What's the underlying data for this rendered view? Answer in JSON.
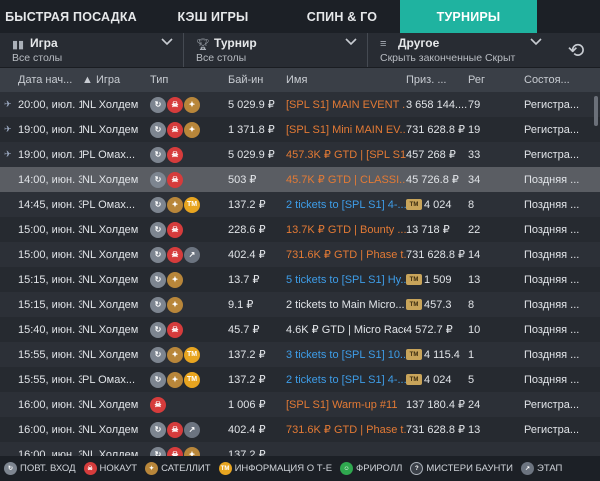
{
  "tabs": [
    "БЫСТРАЯ ПОСАДКА",
    "КЭШ ИГРЫ",
    "СПИН & ГО",
    "ТУРНИРЫ"
  ],
  "filters": [
    {
      "title": "Игра",
      "sub": "Все столы"
    },
    {
      "title": "Турнир",
      "sub": "Все столы"
    },
    {
      "title": "Другое",
      "sub": "Скрыть законченные Скрыт"
    }
  ],
  "headers": [
    "Дата нач...",
    "Игра",
    "Тип",
    "Бай-ин",
    "Имя",
    "Приз. ...",
    "Рег",
    "Состоя..."
  ],
  "rows": [
    {
      "pin": true,
      "date": "20:00, июл. 12",
      "game": "NL Холдем",
      "types": [
        "rebuy",
        "ko",
        "sat"
      ],
      "buyin": "5 029.9 ₽",
      "name": "[SPL S1] MAIN EVENT ...",
      "nameColor": "orange",
      "prize": "3 658 144....",
      "ticket": false,
      "reg": "79",
      "status": "Регистра...",
      "sel": false
    },
    {
      "pin": true,
      "date": "19:00, июл. 12",
      "game": "NL Холдем",
      "types": [
        "rebuy",
        "ko",
        "sat"
      ],
      "buyin": "1 371.8 ₽",
      "name": "[SPL S1] Mini MAIN EV...",
      "nameColor": "orange",
      "prize": "731 628.8 ₽",
      "ticket": false,
      "reg": "19",
      "status": "Регистра...",
      "sel": false
    },
    {
      "pin": true,
      "date": "19:00, июл. 13",
      "game": "PL Омах...",
      "types": [
        "rebuy",
        "ko"
      ],
      "buyin": "5 029.9 ₽",
      "name": "457.3K ₽ GTD | [SPL S1]...",
      "nameColor": "orange",
      "prize": "457 268 ₽",
      "ticket": false,
      "reg": "33",
      "status": "Регистра...",
      "sel": false
    },
    {
      "pin": false,
      "date": "14:00, июн. 30",
      "game": "NL Холдем",
      "types": [
        "rebuy",
        "ko"
      ],
      "buyin": "503 ₽",
      "name": "45.7K ₽ GTD | CLASSI...",
      "nameColor": "orange",
      "prize": "45 726.8 ₽",
      "ticket": false,
      "reg": "34",
      "status": "Поздняя ...",
      "sel": true
    },
    {
      "pin": false,
      "date": "14:45, июн. 30",
      "game": "PL Омах...",
      "types": [
        "rebuy",
        "sat",
        "tm"
      ],
      "buyin": "137.2 ₽",
      "name": "2 tickets to [SPL S1] 4-...",
      "nameColor": "blue",
      "prize": "4 024",
      "ticket": true,
      "reg": "8",
      "status": "Поздняя ...",
      "sel": false
    },
    {
      "pin": false,
      "date": "15:00, июн. 30",
      "game": "NL Холдем",
      "types": [
        "rebuy",
        "ko"
      ],
      "buyin": "228.6 ₽",
      "name": "13.7K ₽ GTD | Bounty ...",
      "nameColor": "orange",
      "prize": "13 718 ₽",
      "ticket": false,
      "reg": "22",
      "status": "Поздняя ...",
      "sel": false
    },
    {
      "pin": false,
      "date": "15:00, июн. 30",
      "game": "NL Холдем",
      "types": [
        "rebuy",
        "ko",
        "stage"
      ],
      "buyin": "402.4 ₽",
      "name": "731.6K ₽ GTD | Phase t...",
      "nameColor": "orange",
      "prize": "731 628.8 ₽",
      "ticket": false,
      "reg": "14",
      "status": "Поздняя ...",
      "sel": false
    },
    {
      "pin": false,
      "date": "15:15, июн. 30",
      "game": "NL Холдем",
      "types": [
        "rebuy",
        "sat"
      ],
      "buyin": "13.7 ₽",
      "name": "5 tickets to [SPL S1] Hy...",
      "nameColor": "blue",
      "prize": "1 509",
      "ticket": true,
      "reg": "13",
      "status": "Поздняя ...",
      "sel": false
    },
    {
      "pin": false,
      "date": "15:15, июн. 30",
      "game": "NL Холдем",
      "types": [
        "rebuy",
        "sat"
      ],
      "buyin": "9.1 ₽",
      "name": "2 tickets to Main Micro...",
      "nameColor": "white",
      "prize": "457.3",
      "ticket": true,
      "reg": "8",
      "status": "Поздняя ...",
      "sel": false
    },
    {
      "pin": false,
      "date": "15:40, июн. 30",
      "game": "NL Холдем",
      "types": [
        "rebuy",
        "ko"
      ],
      "buyin": "45.7 ₽",
      "name": "4.6K ₽ GTD | Micro Race",
      "nameColor": "white",
      "prize": "4 572.7 ₽",
      "ticket": false,
      "reg": "10",
      "status": "Поздняя ...",
      "sel": false
    },
    {
      "pin": false,
      "date": "15:55, июн. 30",
      "game": "NL Холдем",
      "types": [
        "rebuy",
        "sat",
        "tm"
      ],
      "buyin": "137.2 ₽",
      "name": "3 tickets to [SPL S1] 10...",
      "nameColor": "blue",
      "prize": "4 115.4",
      "ticket": true,
      "reg": "1",
      "status": "Поздняя ...",
      "sel": false
    },
    {
      "pin": false,
      "date": "15:55, июн. 30",
      "game": "PL Омах...",
      "types": [
        "rebuy",
        "sat",
        "tm"
      ],
      "buyin": "137.2 ₽",
      "name": "2 tickets to [SPL S1] 4-...",
      "nameColor": "blue",
      "prize": "4 024",
      "ticket": true,
      "reg": "5",
      "status": "Поздняя ...",
      "sel": false
    },
    {
      "pin": false,
      "date": "16:00, июн. 30",
      "game": "NL Холдем",
      "types": [
        "ko"
      ],
      "buyin": "1 006 ₽",
      "name": "[SPL S1] Warm-up  #11",
      "nameColor": "orange",
      "prize": "137 180.4 ₽",
      "ticket": false,
      "reg": "24",
      "status": "Регистра...",
      "sel": false
    },
    {
      "pin": false,
      "date": "16:00, июн. 30",
      "game": "NL Холдем",
      "types": [
        "rebuy",
        "ko",
        "stage"
      ],
      "buyin": "402.4 ₽",
      "name": "731.6K ₽ GTD | Phase t...",
      "nameColor": "orange",
      "prize": "731 628.8 ₽",
      "ticket": false,
      "reg": "13",
      "status": "Регистра...",
      "sel": false
    },
    {
      "pin": false,
      "date": "16:00, июн. 30",
      "game": "NL Холдем",
      "types": [
        "rebuy",
        "ko",
        "sat"
      ],
      "buyin": "137.2 ₽",
      "name": "",
      "nameColor": "orange",
      "prize": "",
      "ticket": false,
      "reg": "",
      "status": "",
      "sel": false
    }
  ],
  "legend": [
    {
      "icon": "rebuy",
      "label": "ПОВТ. ВХОД"
    },
    {
      "icon": "ko",
      "label": "НОКАУТ"
    },
    {
      "icon": "sat",
      "label": "САТЕЛЛИТ"
    },
    {
      "icon": "tm",
      "label": "ИНФОРМАЦИЯ О Т-Е"
    },
    {
      "icon": "fr",
      "label": "ФРИРОЛЛ"
    },
    {
      "icon": "mb",
      "label": "МИСТЕРИ БАУНТИ"
    },
    {
      "icon": "stage",
      "label": "ЭТАП"
    }
  ],
  "colors": {
    "accent": "#1fb3a0",
    "orange": "#e37a35",
    "blue": "#3e9de8"
  }
}
